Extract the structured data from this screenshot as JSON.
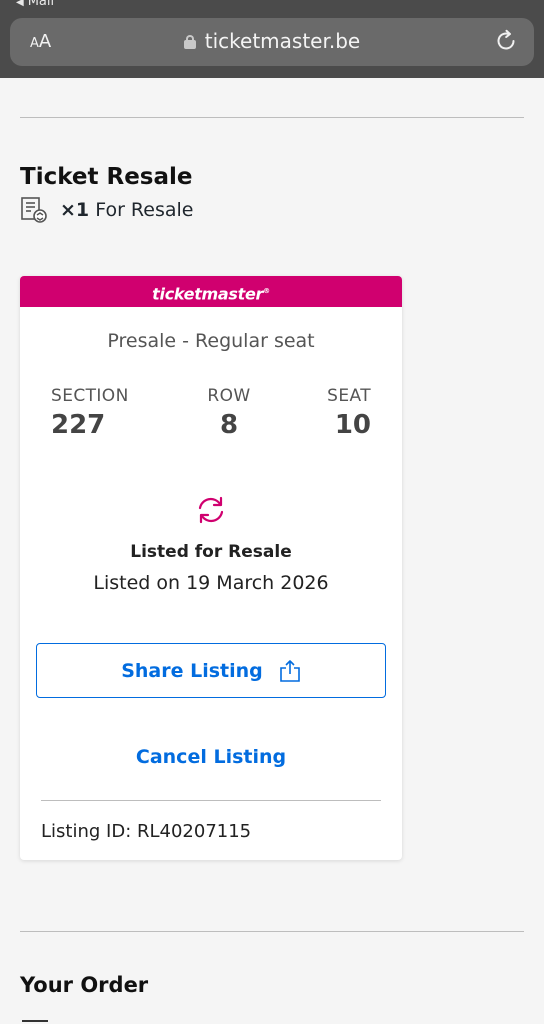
{
  "browser": {
    "back_app": "Mail",
    "text_size": "AA",
    "url": "ticketmaster.be"
  },
  "ticket_resale": {
    "title": "Ticket Resale",
    "count": "×1",
    "for_resale": "For Resale"
  },
  "card": {
    "brand": "ticketmaster",
    "seat_type": "Presale - Regular seat",
    "section_label": "SECTION",
    "section_value": "227",
    "row_label": "ROW",
    "row_value": "8",
    "seat_label": "SEAT",
    "seat_value": "10",
    "status": "Listed for Resale",
    "listed_on": "Listed on 19 March 2026",
    "share_label": "Share Listing",
    "cancel_label": "Cancel Listing",
    "listing_id": "Listing ID: RL40207115"
  },
  "order": {
    "title": "Your Order"
  },
  "colors": {
    "brand": "#d0006f",
    "link": "#026cdf"
  }
}
